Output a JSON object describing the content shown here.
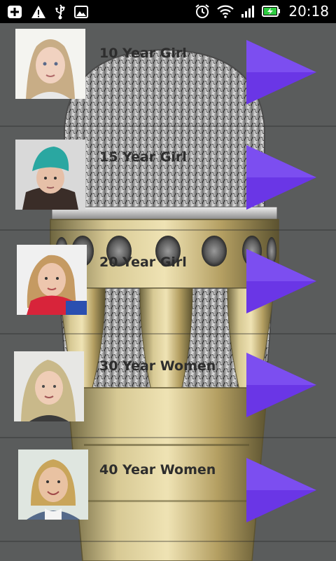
{
  "status_bar": {
    "time": "20:18",
    "icons_left": [
      "add-box-icon",
      "warning-icon",
      "usb-icon",
      "image-icon"
    ],
    "icons_right": [
      "alarm-icon",
      "wifi-icon",
      "signal-icon",
      "battery-charging-icon"
    ]
  },
  "voices": [
    {
      "label": "10 Year Girl"
    },
    {
      "label": "15 Year Girl"
    },
    {
      "label": "20 Year Girl"
    },
    {
      "label": "30 Year Women"
    },
    {
      "label": "40 Year Women"
    }
  ],
  "colors": {
    "play_button": "#6a36e6",
    "background": "#5a5c5c",
    "microphone": "#b8a466"
  }
}
